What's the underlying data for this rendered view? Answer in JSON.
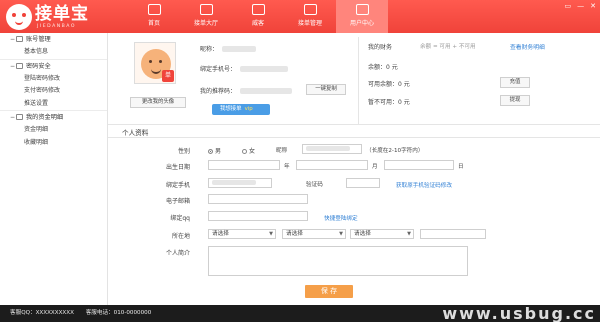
{
  "app": {
    "logo_text": "接单宝",
    "logo_sub": "JIEDANBAO"
  },
  "nav": [
    {
      "label": "首页",
      "icon": "home-icon"
    },
    {
      "label": "接单大厅",
      "icon": "hall-icon"
    },
    {
      "label": "威客",
      "icon": "witkey-icon"
    },
    {
      "label": "接单管理",
      "icon": "order-manage-icon"
    },
    {
      "label": "用户中心",
      "icon": "user-center-icon",
      "active": true
    }
  ],
  "window_controls": [
    "▭",
    "—",
    "✕"
  ],
  "sidebar": {
    "groups": [
      {
        "title": "账号管理",
        "items": [
          "基本信息"
        ]
      },
      {
        "title": "密码安全",
        "items": [
          "登陆密码修改",
          "支付密码修改",
          "推送设置"
        ]
      },
      {
        "title": "我的资金明细",
        "items": [
          "资金明细",
          "收藏明细"
        ]
      }
    ],
    "toggle_symbol": "−"
  },
  "profile": {
    "change_avatar": "更改我的头像",
    "avatar_badge": "单",
    "nickname_label": "昵称：",
    "phone_label": "绑定手机号：",
    "referral_label": "我的推荐码：",
    "copy_button": "一键复制",
    "invite_button": "我想接单",
    "invite_vip": "vip"
  },
  "finance": {
    "title": "我的财务",
    "legend": "余额 = 可用 + 不可用",
    "link": "查看财务明细",
    "balance_label": "余额：",
    "balance_value": "0 元",
    "available_label": "可用余额：",
    "available_value": "0 元",
    "unavailable_label": "暂不可用：",
    "unavailable_value": "0 元",
    "recharge_button": "充值",
    "withdraw_button": "提现"
  },
  "form": {
    "section_title": "个人资料",
    "gender_label": "性别",
    "gender_male": "男",
    "gender_female": "女",
    "gender_selected": "男",
    "nickname_label": "昵称",
    "nickname_hint": "（长度在2-10字符内）",
    "birthday_label": "出生日期",
    "year_unit": "年",
    "month_unit": "月",
    "day_unit": "日",
    "phone_label": "绑定手机",
    "verify_label": "验证码",
    "verify_link": "获取原手机验证码修改",
    "email_label": "电子邮箱",
    "qq_label": "绑定qq",
    "qq_link": "快捷登陆绑定",
    "region_label": "所在地",
    "select_placeholder": "请选择",
    "bio_label": "个人简介",
    "save_button": "保 存"
  },
  "footer": {
    "qq": "客服QQ：XXXXXXXXXX",
    "phone": "客服电话：010-0000000",
    "watermark": "www.usbug.cc"
  }
}
